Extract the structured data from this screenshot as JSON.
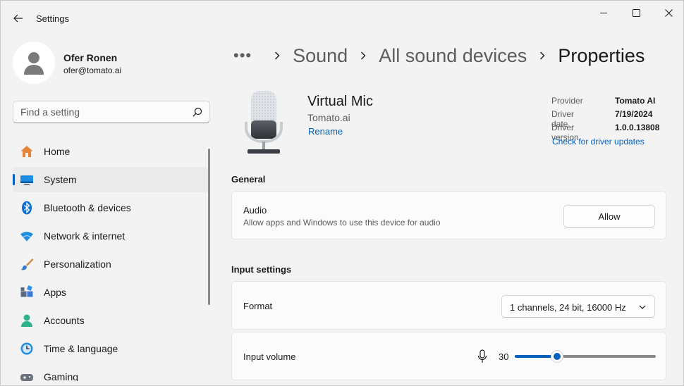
{
  "window": {
    "title": "Settings"
  },
  "profile": {
    "name": "Ofer Ronen",
    "email": "ofer@tomato.ai"
  },
  "search": {
    "placeholder": "Find a setting"
  },
  "nav": {
    "items": [
      {
        "label": "Home",
        "icon": "home-icon"
      },
      {
        "label": "System",
        "icon": "system-icon",
        "active": true
      },
      {
        "label": "Bluetooth & devices",
        "icon": "bluetooth-icon"
      },
      {
        "label": "Network & internet",
        "icon": "wifi-icon"
      },
      {
        "label": "Personalization",
        "icon": "brush-icon"
      },
      {
        "label": "Apps",
        "icon": "apps-icon"
      },
      {
        "label": "Accounts",
        "icon": "accounts-icon"
      },
      {
        "label": "Time & language",
        "icon": "clock-icon"
      },
      {
        "label": "Gaming",
        "icon": "gamepad-icon"
      }
    ]
  },
  "breadcrumb": {
    "more": "•••",
    "items": [
      "Sound",
      "All sound devices",
      "Properties"
    ]
  },
  "device": {
    "name": "Virtual Mic",
    "vendor": "Tomato.ai",
    "rename": "Rename",
    "meta": [
      {
        "key": "Provider",
        "value": "Tomato AI"
      },
      {
        "key": "Driver date",
        "value": "7/19/2024"
      },
      {
        "key": "Driver version",
        "value": "1.0.0.13808"
      }
    ],
    "update_link": "Check for driver updates"
  },
  "general": {
    "title": "General",
    "audio": {
      "title": "Audio",
      "description": "Allow apps and Windows to use this device for audio",
      "button": "Allow"
    }
  },
  "input_settings": {
    "title": "Input settings",
    "format": {
      "label": "Format",
      "value": "1 channels, 24 bit, 16000 Hz"
    },
    "volume": {
      "label": "Input volume",
      "value": "30",
      "percent": 30
    }
  },
  "colors": {
    "accent": "#005fb8",
    "background": "#f3f3f3",
    "card": "#fbfbfb"
  }
}
